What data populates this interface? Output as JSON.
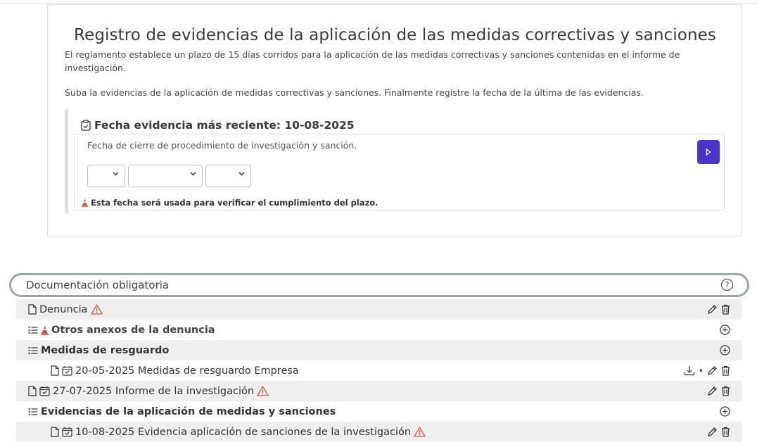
{
  "card": {
    "title": "Registro de evidencias de la aplicación de las medidas correctivas y sanciones",
    "description_1": "El reglamento establece un plazo de 15 días corridos para la aplicación de las medidas correctivas y sanciones contenidas en el informe de investigación.",
    "description_2": "Suba la evidencias de la aplicación de medidas correctivas y sanciones. Finalmente registre la fecha de la última de las evidencias.",
    "panel": {
      "title": "Fecha evidencia más reciente: 10-08-2025",
      "field_label": "Fecha de cierre de procedimiento de investigación y sanción.",
      "selects": [
        "",
        "",
        ""
      ],
      "note": "Esta fecha será usada para verificar el cumplimiento del plazo."
    }
  },
  "documents": {
    "header": "Documentación obligatoria",
    "rows": [
      {
        "label": "Denuncia"
      },
      {
        "label": "Otros anexos de la denuncia"
      },
      {
        "label": "Medidas de resguardo"
      },
      {
        "label": "20-05-2025 Medidas de resguardo Empresa"
      },
      {
        "label": "27-07-2025 Informe de la investigación"
      },
      {
        "label": "Evidencias de la aplicación de medidas y sanciones"
      },
      {
        "label": "10-08-2025 Evidencia aplicación de sanciones de la investigación"
      }
    ]
  },
  "colors": {
    "accent": "#4b32c9",
    "warning": "#d9534f",
    "cone": "#d9534f"
  }
}
